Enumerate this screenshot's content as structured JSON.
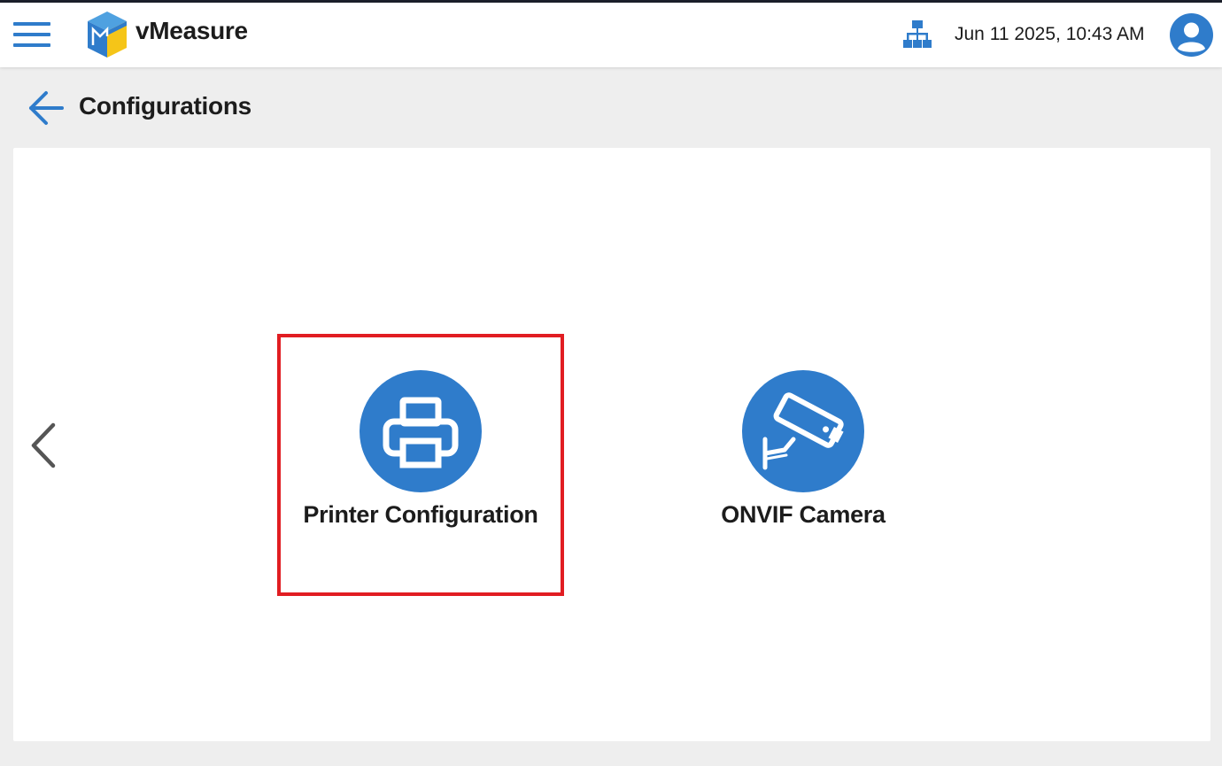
{
  "header": {
    "app_name": "vMeasure",
    "datetime": "Jun 11 2025, 10:43 AM"
  },
  "page": {
    "title": "Configurations"
  },
  "tiles": [
    {
      "label": "Printer Configuration",
      "icon": "printer-icon",
      "highlighted": true
    },
    {
      "label": "ONVIF Camera",
      "icon": "cctv-camera-icon",
      "highlighted": false
    }
  ],
  "colors": {
    "accent": "#2f7ccb",
    "highlight": "#e11d22",
    "background": "#eeeeee",
    "logo_top": "#4fa1e0",
    "logo_front": "#f5c518"
  }
}
